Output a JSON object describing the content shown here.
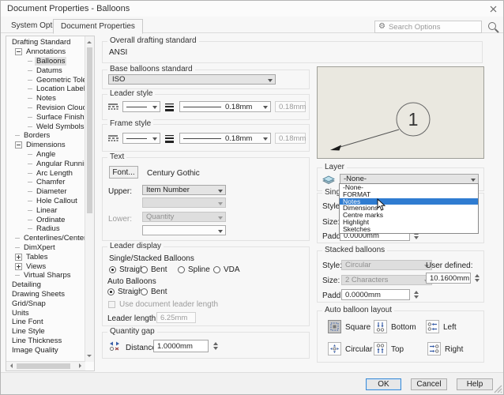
{
  "window": {
    "title": "Document Properties - Balloons"
  },
  "tabs": {
    "system": "System Options",
    "document": "Document Properties"
  },
  "search": {
    "placeholder": "Search Options"
  },
  "tree": {
    "items": [
      {
        "label": "Drafting Standard",
        "level": 0,
        "exp": null,
        "selected": false
      },
      {
        "label": "Annotations",
        "level": 1,
        "exp": "minus",
        "selected": false
      },
      {
        "label": "Balloons",
        "level": 2,
        "exp": null,
        "selected": true
      },
      {
        "label": "Datums",
        "level": 2,
        "exp": null,
        "selected": false
      },
      {
        "label": "Geometric Tolerance",
        "level": 2,
        "exp": null,
        "selected": false
      },
      {
        "label": "Location Label",
        "level": 2,
        "exp": null,
        "selected": false
      },
      {
        "label": "Notes",
        "level": 2,
        "exp": null,
        "selected": false
      },
      {
        "label": "Revision Clouds",
        "level": 2,
        "exp": null,
        "selected": false
      },
      {
        "label": "Surface Finishes",
        "level": 2,
        "exp": null,
        "selected": false
      },
      {
        "label": "Weld Symbols",
        "level": 2,
        "exp": null,
        "selected": false
      },
      {
        "label": "Borders",
        "level": 1,
        "exp": null,
        "selected": false
      },
      {
        "label": "Dimensions",
        "level": 1,
        "exp": "minus",
        "selected": false
      },
      {
        "label": "Angle",
        "level": 2,
        "exp": null,
        "selected": false
      },
      {
        "label": "Angular Running",
        "level": 2,
        "exp": null,
        "selected": false
      },
      {
        "label": "Arc Length",
        "level": 2,
        "exp": null,
        "selected": false
      },
      {
        "label": "Chamfer",
        "level": 2,
        "exp": null,
        "selected": false
      },
      {
        "label": "Diameter",
        "level": 2,
        "exp": null,
        "selected": false
      },
      {
        "label": "Hole Callout",
        "level": 2,
        "exp": null,
        "selected": false
      },
      {
        "label": "Linear",
        "level": 2,
        "exp": null,
        "selected": false
      },
      {
        "label": "Ordinate",
        "level": 2,
        "exp": null,
        "selected": false
      },
      {
        "label": "Radius",
        "level": 2,
        "exp": null,
        "selected": false
      },
      {
        "label": "Centerlines/Center Mark",
        "level": 1,
        "exp": null,
        "selected": false
      },
      {
        "label": "DimXpert",
        "level": 1,
        "exp": null,
        "selected": false
      },
      {
        "label": "Tables",
        "level": 1,
        "exp": "plus",
        "selected": false
      },
      {
        "label": "Views",
        "level": 1,
        "exp": "plus",
        "selected": false
      },
      {
        "label": "Virtual Sharps",
        "level": 1,
        "exp": null,
        "selected": false
      },
      {
        "label": "Detailing",
        "level": 0,
        "exp": null,
        "selected": false
      },
      {
        "label": "Drawing Sheets",
        "level": 0,
        "exp": null,
        "selected": false
      },
      {
        "label": "Grid/Snap",
        "level": 0,
        "exp": null,
        "selected": false
      },
      {
        "label": "Units",
        "level": 0,
        "exp": null,
        "selected": false
      },
      {
        "label": "Line Font",
        "level": 0,
        "exp": null,
        "selected": false
      },
      {
        "label": "Line Style",
        "level": 0,
        "exp": null,
        "selected": false
      },
      {
        "label": "Line Thickness",
        "level": 0,
        "exp": null,
        "selected": false
      },
      {
        "label": "Image Quality",
        "level": 0,
        "exp": null,
        "selected": false
      }
    ]
  },
  "main": {
    "overall": {
      "label": "Overall drafting standard",
      "value": "ANSI"
    },
    "base_standard": {
      "label": "Base balloons standard",
      "value": "ISO"
    },
    "leader_style": {
      "label": "Leader style",
      "thickness_value": "0.18mm",
      "custom_thickness": "0.18mm"
    },
    "frame_style": {
      "label": "Frame style",
      "thickness_value": "0.18mm",
      "custom_thickness": "0.18mm"
    },
    "text": {
      "label": "Text",
      "font_button": "Font...",
      "font_name": "Century Gothic",
      "upper_label": "Upper:",
      "upper_value": "Item Number",
      "lower_label": "Lower:",
      "lower_value": "Quantity"
    },
    "leader_display": {
      "label": "Leader display",
      "single_stacked_label": "Single/Stacked Balloons",
      "single_options": [
        "Straight",
        "Bent",
        "Spline",
        "VDA"
      ],
      "single_selected": "Straight",
      "auto_label": "Auto Balloons",
      "auto_options": [
        "Straight",
        "Bent"
      ],
      "auto_selected": "Straight",
      "use_doc_checkbox": "Use document leader length",
      "leader_length_label": "Leader length:",
      "leader_length_value": "6.25mm"
    },
    "quantity_gap": {
      "label": "Quantity gap",
      "distance_label": "Distance:",
      "distance_value": "1.0000mm"
    }
  },
  "right": {
    "preview": {
      "balloon_text": "1"
    },
    "layer": {
      "label": "Layer",
      "value": "-None-",
      "options": [
        "-None-",
        "FORMAT",
        "Notes",
        "Dimensions",
        "Centre marks",
        "Highlight",
        "Sketches"
      ],
      "highlighted_option": "Notes"
    },
    "single_balloon": {
      "label": "Single balloon",
      "style_label": "Style:",
      "size_label": "Size:",
      "padding_label": "Padding:",
      "padding_value": "0.0000mm"
    },
    "stacked_balloons": {
      "label": "Stacked balloons",
      "style_label": "Style:",
      "style_value": "Circular",
      "size_label": "Size:",
      "size_value": "2 Characters",
      "user_defined_label": "User defined:",
      "user_defined_value": "10.1600mm",
      "padding_label": "Padding:",
      "padding_value": "0.0000mm"
    },
    "auto_layout": {
      "label": "Auto balloon layout",
      "buttons": [
        {
          "label": "Square",
          "selected": true
        },
        {
          "label": "Bottom",
          "selected": false
        },
        {
          "label": "Left",
          "selected": false
        },
        {
          "label": "Circular",
          "selected": false
        },
        {
          "label": "Top",
          "selected": false
        },
        {
          "label": "Right",
          "selected": false
        }
      ]
    }
  },
  "footer": {
    "ok": "OK",
    "cancel": "Cancel",
    "help": "Help"
  },
  "colors": {
    "highlight": "#2f7cd1",
    "icon_blue": "#3a5fa8",
    "preview_bg": "#eae8e0"
  }
}
